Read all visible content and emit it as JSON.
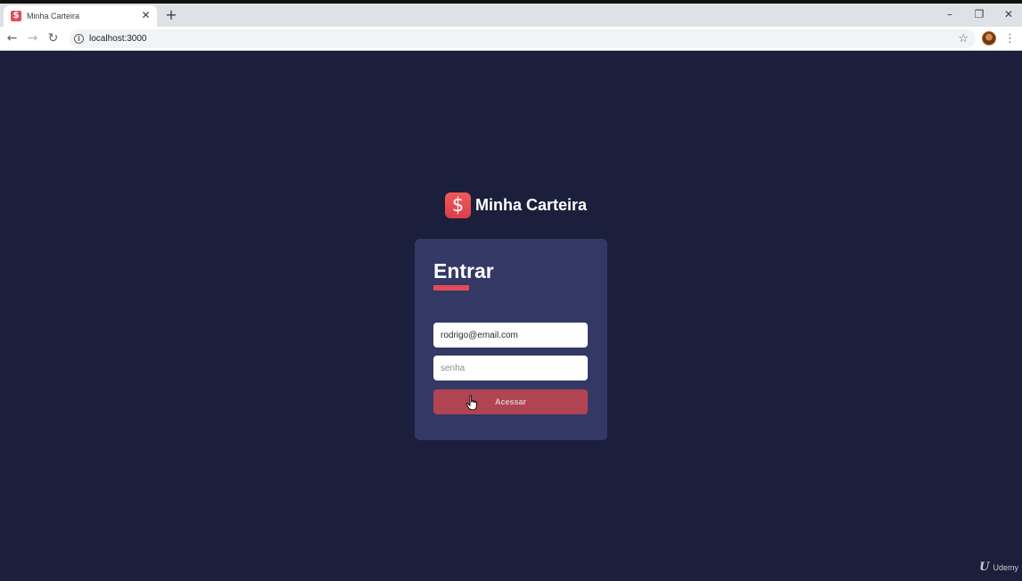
{
  "browser": {
    "tab_title": "Minha Carteira",
    "favicon_glyph": "$",
    "tab_close_glyph": "✕",
    "new_tab_glyph": "+",
    "url": "localhost:3000",
    "window_controls": {
      "minimize": "–",
      "restore": "❐",
      "close": "✕"
    },
    "nav": {
      "back": "←",
      "forward": "→",
      "reload": "↻"
    },
    "star_glyph": "☆",
    "menu_glyph": "⋮"
  },
  "app": {
    "logo_glyph": "$",
    "brand_name": "Minha Carteira",
    "login": {
      "title": "Entrar",
      "email_value": "rodrigo@email.com",
      "password_placeholder": "senha",
      "submit_label": "Acessar"
    }
  },
  "watermark": {
    "logo": "U",
    "text": "Udemy"
  },
  "colors": {
    "background": "#1c1f3b",
    "card": "#333865",
    "accent": "#e44c55",
    "button": "#b14452"
  },
  "icons": {
    "favicon": "dollar-icon",
    "logo": "dollar-icon",
    "cursor": "hand-pointer-icon"
  }
}
